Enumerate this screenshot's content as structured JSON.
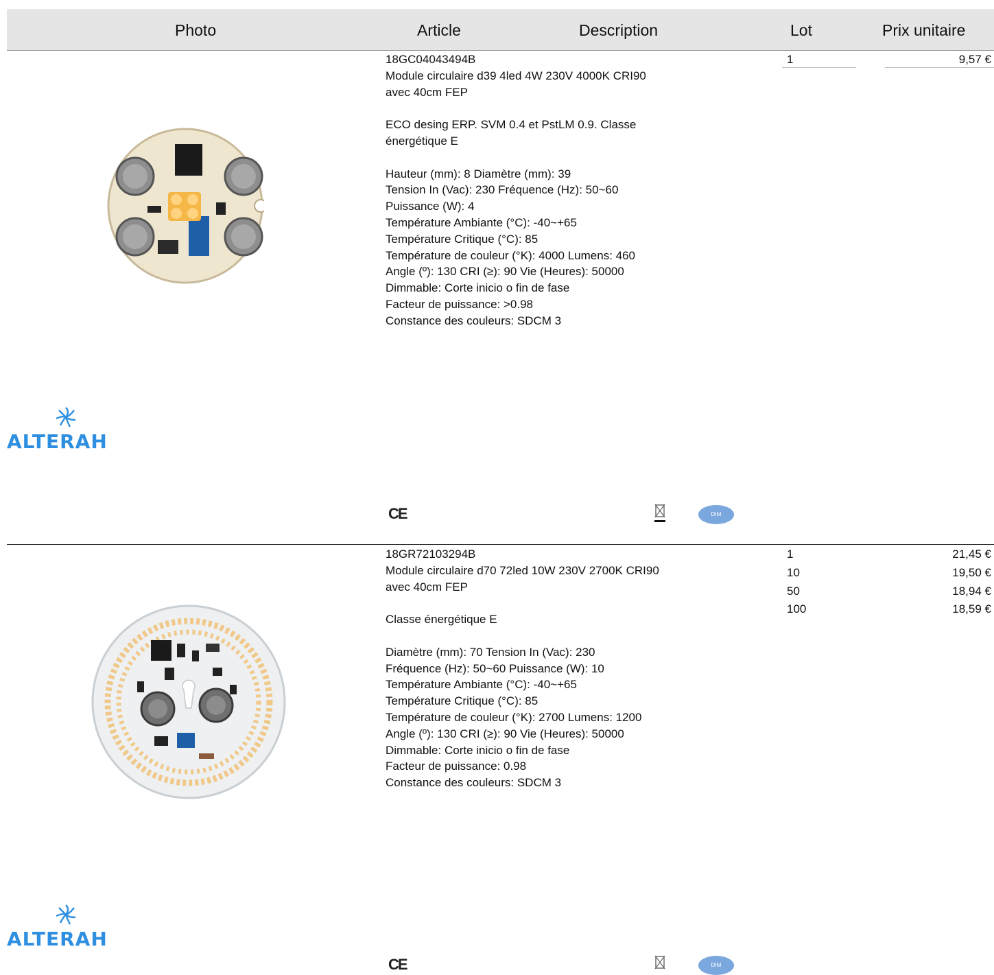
{
  "header": {
    "photo": "Photo",
    "article": "Article",
    "description": "Description",
    "lot": "Lot",
    "prix_unitaire": "Prix unitaire"
  },
  "products": [
    {
      "code": "18GC04043494B",
      "lines": [
        "Module circulaire d39 4led 4W 230V 4000K CRI90",
        "avec 40cm FEP",
        "",
        "ECO desing ERP. SVM 0.4 et PstLM 0.9. Classe",
        "énergétique E",
        "",
        "Hauteur (mm): 8 Diamètre (mm): 39",
        "Tension In (Vac): 230 Fréquence (Hz): 50~60",
        "Puissance (W): 4",
        "Température Ambiante (°C): -40~+65",
        "Température Critique (°C): 85",
        "Température de couleur (°K): 4000 Lumens: 460",
        "Angle (º): 130 CRI (≥): 90 Vie (Heures): 50000",
        "Dimmable: Corte inicio o fin de fase",
        "Facteur de puissance: >0.98",
        "Constance des couleurs: SDCM 3"
      ],
      "lots": [
        "1"
      ],
      "prices": [
        "9,57 €"
      ],
      "brand": "ALTERAH",
      "ce": "CE",
      "dim_label": "DIM"
    },
    {
      "code": "18GR72103294B",
      "lines": [
        "Module circulaire d70 72led 10W 230V 2700K CRI90",
        "avec 40cm FEP",
        "",
        "Classe énergétique E",
        "",
        "Diamètre (mm): 70 Tension In (Vac): 230",
        "Fréquence (Hz): 50~60 Puissance (W): 10",
        "Température Ambiante (°C): -40~+65",
        "Température Critique (°C): 85",
        "Température de couleur (°K): 2700 Lumens: 1200",
        "Angle (º): 130 CRI (≥): 90 Vie (Heures): 50000",
        "Dimmable: Corte inicio o fin de fase",
        "Facteur de puissance: 0.98",
        "Constance des couleurs: SDCM 3"
      ],
      "lots": [
        "1",
        "10",
        "50",
        "100"
      ],
      "prices": [
        "21,45 €",
        "19,50 €",
        "18,94 €",
        "18,59 €"
      ],
      "brand": "ALTERAH",
      "ce": "CE",
      "dim_label": "DIM"
    }
  ]
}
